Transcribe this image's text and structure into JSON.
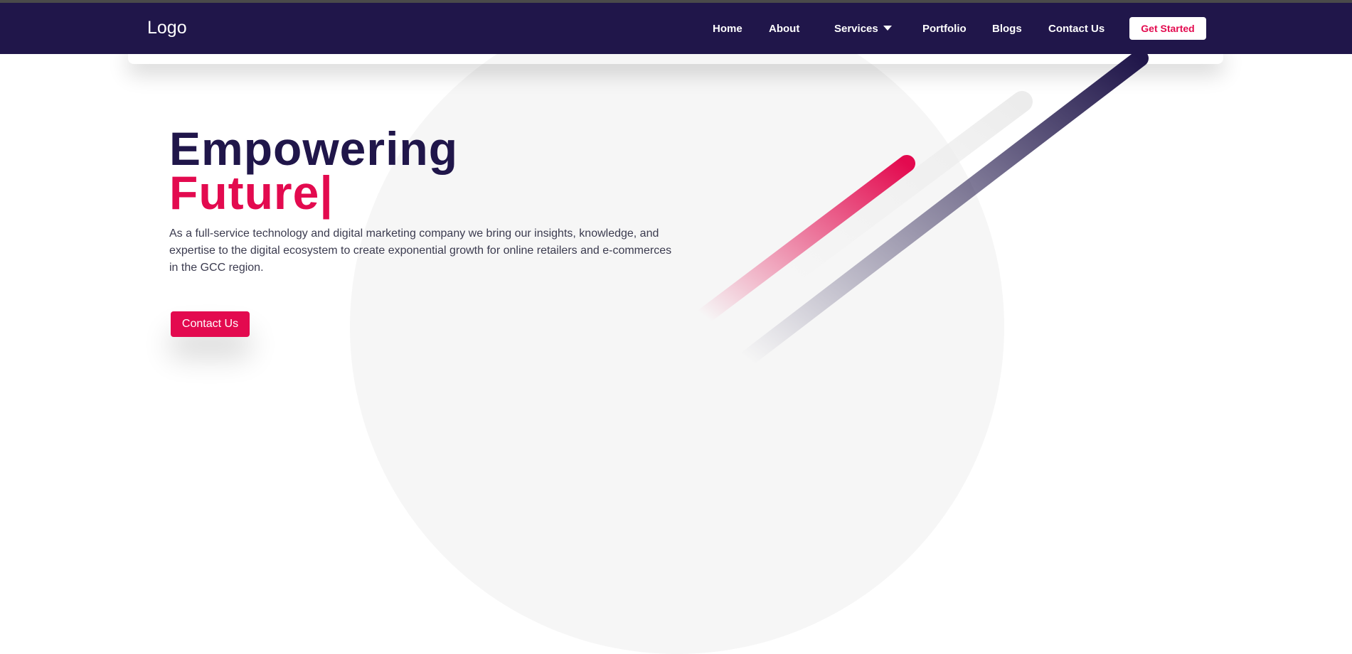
{
  "nav": {
    "logo": "Logo",
    "items": [
      {
        "label": "Home"
      },
      {
        "label": "About"
      },
      {
        "label": "Services"
      },
      {
        "label": "Portfolio"
      },
      {
        "label": "Blogs"
      },
      {
        "label": "Contact Us"
      }
    ],
    "cta_label": "Get Started"
  },
  "hero": {
    "title_line1": "Empowering",
    "title_line2": "Future|",
    "description": "As a full-service technology and digital marketing company we bring our insights, knowledge, and expertise to the digital ecosystem to create exponential growth for online retailers and e-commerces in the GCC region.",
    "button_label": "Contact Us"
  },
  "colors": {
    "navy": "#20164a",
    "accent": "#e30a4f",
    "background_circle": "#f6f6f6"
  }
}
